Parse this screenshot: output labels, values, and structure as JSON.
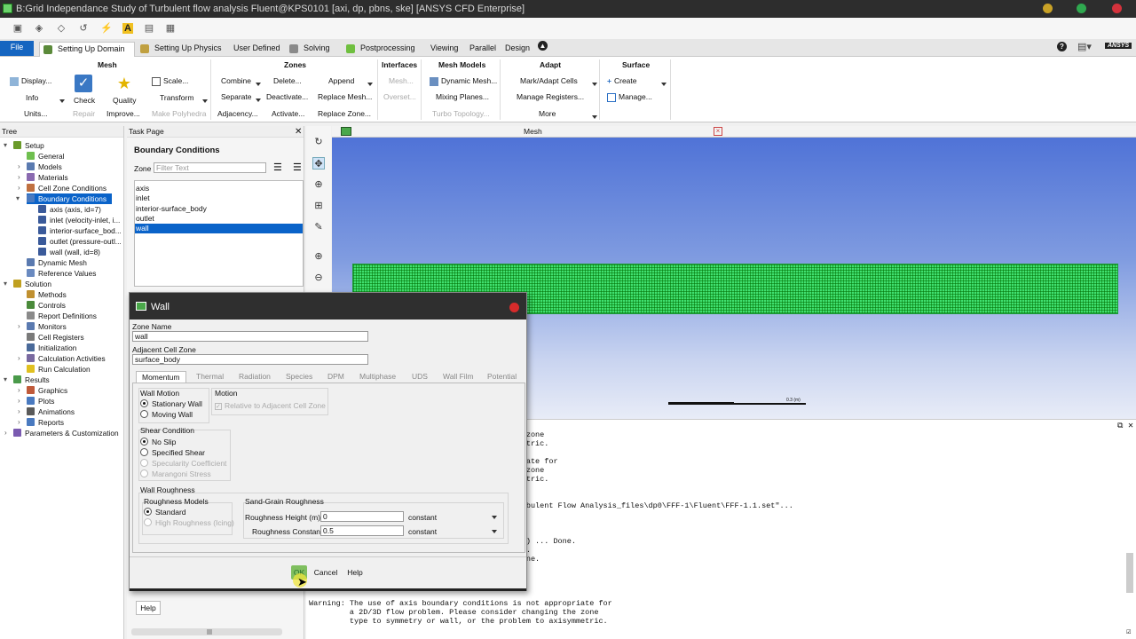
{
  "window": {
    "title": "B:Grid Independance Study of Turbulent flow analysis Fluent@KPS0101  [axi, dp, pbns, ske] [ANSYS CFD Enterprise]"
  },
  "tabs": [
    "File",
    "Setting Up Domain",
    "Setting Up Physics",
    "User Defined",
    "Solving",
    "Postprocessing",
    "Viewing",
    "Parallel",
    "Design"
  ],
  "brand": "ANSYS",
  "ribbon": {
    "mesh": {
      "title": "Mesh",
      "display": "Display...",
      "info": "Info",
      "units": "Units...",
      "check": "Check",
      "quality": "Quality",
      "repair": "Repair",
      "improve": "Improve...",
      "scale": "Scale...",
      "transform": "Transform",
      "make_polyhedra": "Make Polyhedra"
    },
    "zones": {
      "title": "Zones",
      "combine": "Combine",
      "separate": "Separate",
      "adjacency": "Adjacency...",
      "delete": "Delete...",
      "deactivate": "Deactivate...",
      "activate": "Activate...",
      "append": "Append",
      "replace_mesh": "Replace Mesh...",
      "replace_zone": "Replace Zone..."
    },
    "interfaces": {
      "title": "Interfaces",
      "mesh": "Mesh...",
      "overset": "Overset..."
    },
    "mesh_models": {
      "title": "Mesh Models",
      "dynamic_mesh": "Dynamic Mesh...",
      "mixing_planes": "Mixing Planes...",
      "turbo_topology": "Turbo Topology..."
    },
    "adapt": {
      "title": "Adapt",
      "mark_adapt": "Mark/Adapt Cells",
      "manage_registers": "Manage Registers...",
      "more": "More"
    },
    "surface": {
      "title": "Surface",
      "create": "Create",
      "manage": "Manage..."
    }
  },
  "tree": {
    "header": "Tree",
    "items": [
      "Setup",
      "General",
      "Models",
      "Materials",
      "Cell Zone Conditions",
      "Boundary Conditions",
      "axis (axis, id=7)",
      "inlet (velocity-inlet, i...",
      "interior-surface_bod...",
      "outlet (pressure-outl...",
      "wall (wall, id=8)",
      "Dynamic Mesh",
      "Reference Values",
      "Solution",
      "Methods",
      "Controls",
      "Report Definitions",
      "Monitors",
      "Cell Registers",
      "Initialization",
      "Calculation Activities",
      "Run Calculation",
      "Results",
      "Graphics",
      "Plots",
      "Animations",
      "Reports",
      "Parameters & Customization"
    ]
  },
  "task": {
    "header": "Task Page",
    "title": "Boundary Conditions",
    "zone_label": "Zone",
    "filter_placeholder": "Filter Text",
    "zones": [
      "axis",
      "inlet",
      "interior-surface_body",
      "outlet",
      "wall"
    ],
    "help": "Help"
  },
  "graphics": {
    "tab_title": "Mesh",
    "scale_label": "0.3 (m)"
  },
  "console": {
    "lines": [
      "                                        ing the zone",
      "                                        axisymmetric.",
      "",
      "                                        appropriate for",
      "                                        ing the zone",
      "                                        axisymmetric.",
      "",
      "",
      "                                        ysis\\Turbulent Flow Analysis_files\\dp0\\FFF-1\\Fluent\\FFF-1.1.set\"...",
      "",
      "",
      "                                         Done.",
      "                                        (mixture) ... Done.",
      "                                        ... Done.",
      "                                        ) ... Done.",
      "",
      "",
      "",
      "",
      "Warning: The use of axis boundary conditions is not appropriate for",
      "         a 2D/3D flow problem. Please consider changing the zone",
      "         type to symmetry or wall, or the problem to axisymmetric."
    ]
  },
  "dialog": {
    "title": "Wall",
    "zone_name_label": "Zone Name",
    "zone_name": "wall",
    "adjacent_label": "Adjacent Cell Zone",
    "adjacent": "surface_body",
    "tabs": [
      "Momentum",
      "Thermal",
      "Radiation",
      "Species",
      "DPM",
      "Multiphase",
      "UDS",
      "Wall Film",
      "Potential"
    ],
    "wall_motion": {
      "title": "Wall Motion",
      "stationary": "Stationary Wall",
      "moving": "Moving Wall"
    },
    "motion": {
      "title": "Motion",
      "relative": "Relative to Adjacent Cell Zone"
    },
    "shear": {
      "title": "Shear Condition",
      "no_slip": "No Slip",
      "specified": "Specified Shear",
      "specularity": "Specularity Coefficient",
      "marangoni": "Marangoni Stress"
    },
    "roughness": {
      "title": "Wall Roughness",
      "models_title": "Roughness Models",
      "standard": "Standard",
      "high": "High Roughness (Icing)",
      "sand_title": "Sand-Grain Roughness",
      "height_label": "Roughness Height (m)",
      "height_value": "0",
      "height_method": "constant",
      "constant_label": "Roughness Constant",
      "constant_value": "0.5",
      "constant_method": "constant"
    },
    "buttons": {
      "ok": "OK",
      "cancel": "Cancel",
      "help": "Help"
    }
  }
}
